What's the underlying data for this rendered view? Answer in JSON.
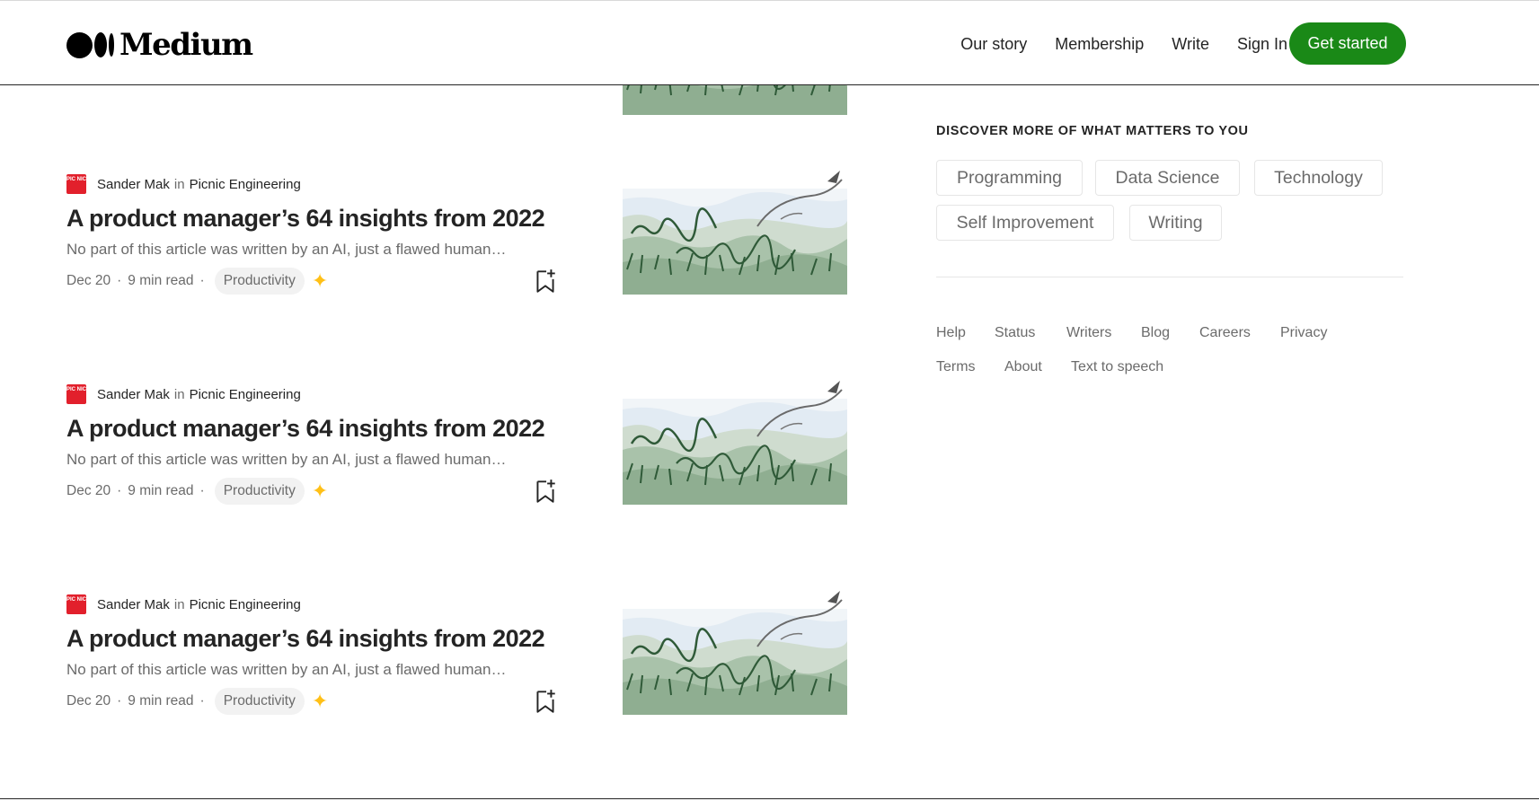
{
  "header": {
    "logo_text": "Medium",
    "nav": [
      "Our story",
      "Membership",
      "Write",
      "Sign In"
    ],
    "cta": "Get started"
  },
  "articles": [
    {
      "publication_icon": "PIC NIC",
      "author": "Sander Mak",
      "in": "in",
      "publication": "Picnic Engineering",
      "title": "A product manager’s 64 insights from 2022",
      "subtitle": "No part of this article was written by an AI, just a flawed human…",
      "date": "Dec 20",
      "read_time": "9 min read",
      "tag": "Productivity",
      "member_only_icon": "star-icon",
      "save_icon": "bookmark-plus-icon"
    },
    {
      "publication_icon": "PIC NIC",
      "author": "Sander Mak",
      "in": "in",
      "publication": "Picnic Engineering",
      "title": "A product manager’s 64 insights from 2022",
      "subtitle": "No part of this article was written by an AI, just a flawed human…",
      "date": "Dec 20",
      "read_time": "9 min read",
      "tag": "Productivity",
      "member_only_icon": "star-icon",
      "save_icon": "bookmark-plus-icon"
    },
    {
      "publication_icon": "PIC NIC",
      "author": "Sander Mak",
      "in": "in",
      "publication": "Picnic Engineering",
      "title": "A product manager’s 64 insights from 2022",
      "subtitle": "No part of this article was written by an AI, just a flawed human…",
      "date": "Dec 20",
      "read_time": "9 min read",
      "tag": "Productivity",
      "member_only_icon": "star-icon",
      "save_icon": "bookmark-plus-icon"
    }
  ],
  "sidebar": {
    "heading": "DISCOVER MORE OF WHAT MATTERS TO YOU",
    "topics": [
      "Programming",
      "Data Science",
      "Technology",
      "Self Improvement",
      "Writing"
    ],
    "footer_links": [
      "Help",
      "Status",
      "Writers",
      "Blog",
      "Careers",
      "Privacy",
      "Terms",
      "About",
      "Text to speech"
    ]
  },
  "colors": {
    "brand_green": "#1a8917",
    "text_primary": "#242424",
    "text_secondary": "#6b6b6b",
    "member_star": "#ffc017",
    "publication_red": "#e2202c"
  }
}
